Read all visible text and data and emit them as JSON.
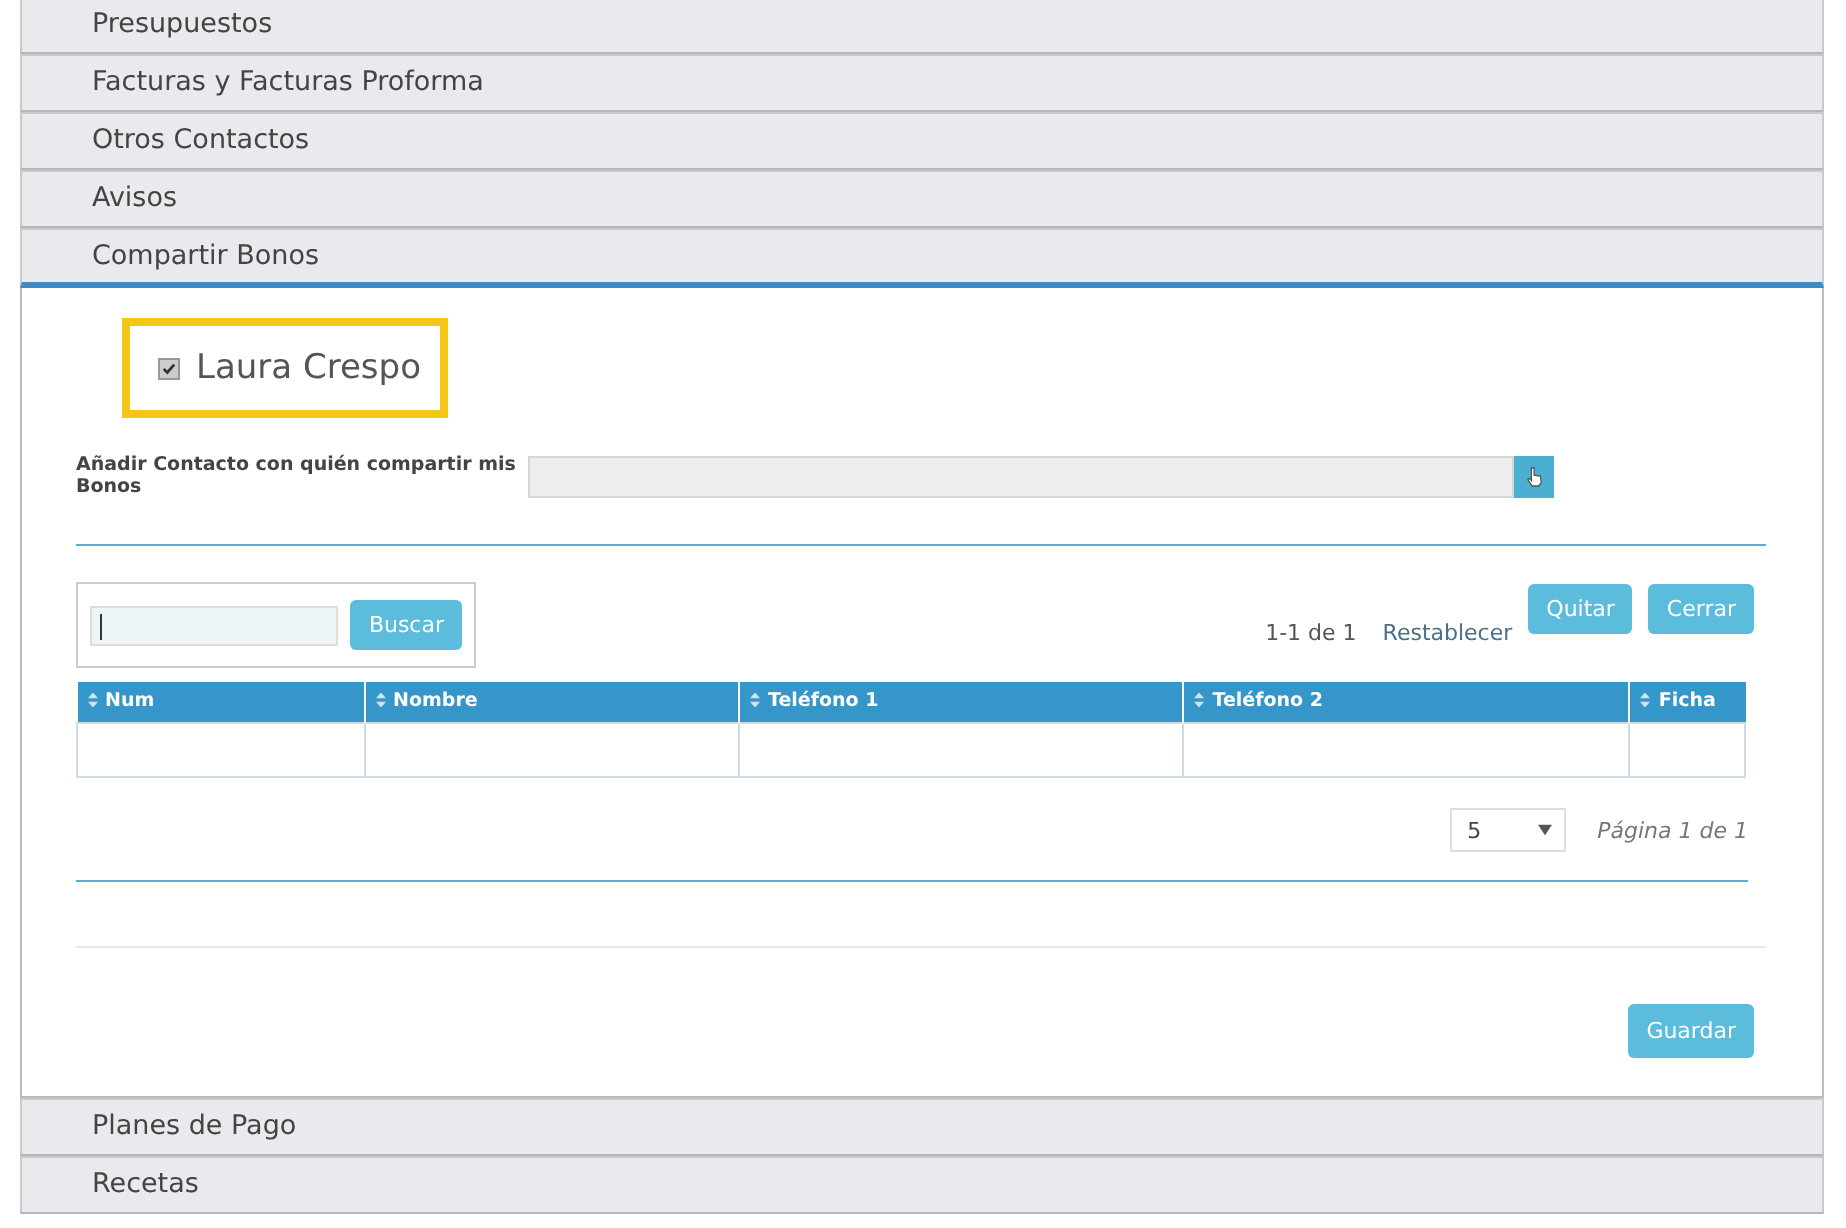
{
  "sections": [
    {
      "title": "Presupuestos",
      "expanded": false
    },
    {
      "title": "Facturas y Facturas Proforma",
      "expanded": false
    },
    {
      "title": "Otros Contactos",
      "expanded": false
    },
    {
      "title": "Avisos",
      "expanded": false
    },
    {
      "title": "Compartir Bonos",
      "expanded": true
    },
    {
      "title": "Planes de Pago",
      "expanded": false
    },
    {
      "title": "Recetas",
      "expanded": false
    }
  ],
  "panel": {
    "owner": {
      "name": "Laura Crespo",
      "checked": true
    },
    "add_contact": {
      "label": "Añadir Contacto con quién compartir mis Bonos"
    },
    "search": {
      "focused": true,
      "button": "Buscar"
    },
    "range": "1-1 de 1",
    "reset_link": "Restablecer",
    "buttons": [
      "Quitar",
      "Cerrar"
    ],
    "table": {
      "columns": [
        "Num",
        "Nombre",
        "Teléfono 1",
        "Teléfono 2",
        "Ficha"
      ]
    },
    "page_size": "5",
    "page_info": "Página 1 de 1",
    "save_button": "Guardar"
  }
}
